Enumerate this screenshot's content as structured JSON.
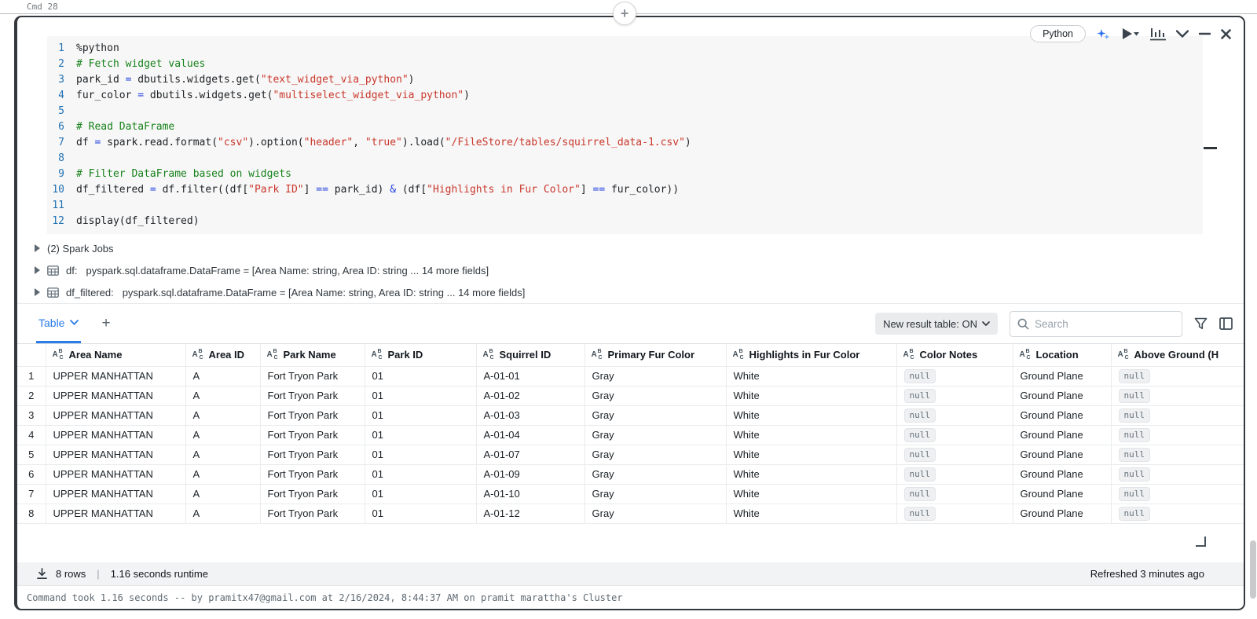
{
  "page": {
    "cmd_label": "Cmd 28"
  },
  "colors": {
    "accent_blue": "#2b7de9",
    "line_number_blue": "#2272b4",
    "comment_green": "#17821b",
    "string_red": "#c9372c",
    "operator_blue": "#2444e0"
  },
  "icons": [
    "plus-icon",
    "sparkle-ai-icon",
    "play-icon",
    "bar-chart-icon",
    "chevron-down-icon",
    "minus-icon",
    "close-icon",
    "expand-caret-icon",
    "dataframe-table-icon",
    "search-icon",
    "filter-funnel-icon",
    "side-panel-icon",
    "string-type-icon",
    "download-icon",
    "resize-corner-icon"
  ],
  "cell": {
    "language_pill": "Python",
    "code": {
      "lines": [
        {
          "n": "1",
          "tokens": [
            [
              "p",
              "%python"
            ]
          ]
        },
        {
          "n": "2",
          "tokens": [
            [
              "c",
              "# Fetch widget values"
            ]
          ]
        },
        {
          "n": "3",
          "tokens": [
            [
              "p",
              "park_id "
            ],
            [
              "o",
              "="
            ],
            [
              "p",
              " dbutils.widgets.get("
            ],
            [
              "s",
              "\"text_widget_via_python\""
            ],
            [
              "p",
              ")"
            ]
          ]
        },
        {
          "n": "4",
          "tokens": [
            [
              "p",
              "fur_color "
            ],
            [
              "o",
              "="
            ],
            [
              "p",
              " dbutils.widgets.get("
            ],
            [
              "s",
              "\"multiselect_widget_via_python\""
            ],
            [
              "p",
              ")"
            ]
          ]
        },
        {
          "n": "5",
          "tokens": []
        },
        {
          "n": "6",
          "tokens": [
            [
              "c",
              "# Read DataFrame"
            ]
          ]
        },
        {
          "n": "7",
          "tokens": [
            [
              "p",
              "df "
            ],
            [
              "o",
              "="
            ],
            [
              "p",
              " spark.read.format("
            ],
            [
              "s",
              "\"csv\""
            ],
            [
              "p",
              ").option("
            ],
            [
              "s",
              "\"header\""
            ],
            [
              "p",
              ", "
            ],
            [
              "s",
              "\"true\""
            ],
            [
              "p",
              ").load("
            ],
            [
              "s",
              "\"/FileStore/tables/squirrel_data-1.csv\""
            ],
            [
              "p",
              ")"
            ]
          ]
        },
        {
          "n": "8",
          "tokens": []
        },
        {
          "n": "9",
          "tokens": [
            [
              "c",
              "# Filter DataFrame based on widgets"
            ]
          ]
        },
        {
          "n": "10",
          "tokens": [
            [
              "p",
              "df_filtered "
            ],
            [
              "o",
              "="
            ],
            [
              "p",
              " df.filter((df["
            ],
            [
              "s",
              "\"Park ID\""
            ],
            [
              "p",
              "] "
            ],
            [
              "o",
              "=="
            ],
            [
              "p",
              " park_id) "
            ],
            [
              "o",
              "&"
            ],
            [
              "p",
              " (df["
            ],
            [
              "s",
              "\"Highlights in Fur Color\""
            ],
            [
              "p",
              "] "
            ],
            [
              "o",
              "=="
            ],
            [
              "p",
              " fur_color))"
            ]
          ]
        },
        {
          "n": "11",
          "tokens": []
        },
        {
          "n": "12",
          "tokens": [
            [
              "p",
              "display(df_filtered)"
            ]
          ]
        }
      ]
    },
    "spark_jobs": {
      "label": "(2) Spark Jobs",
      "dataframes": [
        {
          "name": "df:",
          "desc": "pyspark.sql.dataframe.DataFrame = [Area Name: string, Area ID: string ... 14 more fields]"
        },
        {
          "name": "df_filtered:",
          "desc": "pyspark.sql.dataframe.DataFrame = [Area Name: string, Area ID: string ... 14 more fields]"
        }
      ]
    },
    "result": {
      "tab_label": "Table",
      "new_result_table_label": "New result table: ON",
      "search_placeholder": "Search",
      "table": {
        "headers": [
          "Area Name",
          "Area ID",
          "Park Name",
          "Park ID",
          "Squirrel ID",
          "Primary Fur Color",
          "Highlights in Fur Color",
          "Color Notes",
          "Location",
          "Above Ground (H"
        ],
        "rows": [
          [
            "UPPER MANHATTAN",
            "A",
            "Fort Tryon Park",
            "01",
            "A-01-01",
            "Gray",
            "White",
            "null",
            "Ground Plane",
            "null"
          ],
          [
            "UPPER MANHATTAN",
            "A",
            "Fort Tryon Park",
            "01",
            "A-01-02",
            "Gray",
            "White",
            "null",
            "Ground Plane",
            "null"
          ],
          [
            "UPPER MANHATTAN",
            "A",
            "Fort Tryon Park",
            "01",
            "A-01-03",
            "Gray",
            "White",
            "null",
            "Ground Plane",
            "null"
          ],
          [
            "UPPER MANHATTAN",
            "A",
            "Fort Tryon Park",
            "01",
            "A-01-04",
            "Gray",
            "White",
            "null",
            "Ground Plane",
            "null"
          ],
          [
            "UPPER MANHATTAN",
            "A",
            "Fort Tryon Park",
            "01",
            "A-01-07",
            "Gray",
            "White",
            "null",
            "Ground Plane",
            "null"
          ],
          [
            "UPPER MANHATTAN",
            "A",
            "Fort Tryon Park",
            "01",
            "A-01-09",
            "Gray",
            "White",
            "null",
            "Ground Plane",
            "null"
          ],
          [
            "UPPER MANHATTAN",
            "A",
            "Fort Tryon Park",
            "01",
            "A-01-10",
            "Gray",
            "White",
            "null",
            "Ground Plane",
            "null"
          ],
          [
            "UPPER MANHATTAN",
            "A",
            "Fort Tryon Park",
            "01",
            "A-01-12",
            "Gray",
            "White",
            "null",
            "Ground Plane",
            "null"
          ]
        ]
      },
      "footer": {
        "row_count": "8 rows",
        "separator": "|",
        "runtime": "1.16 seconds runtime",
        "refreshed": "Refreshed 3 minutes ago"
      }
    },
    "status_line": "Command took 1.16 seconds -- by pramitx47@gmail.com at 2/16/2024, 8:44:37 AM on pramit marattha's Cluster"
  }
}
